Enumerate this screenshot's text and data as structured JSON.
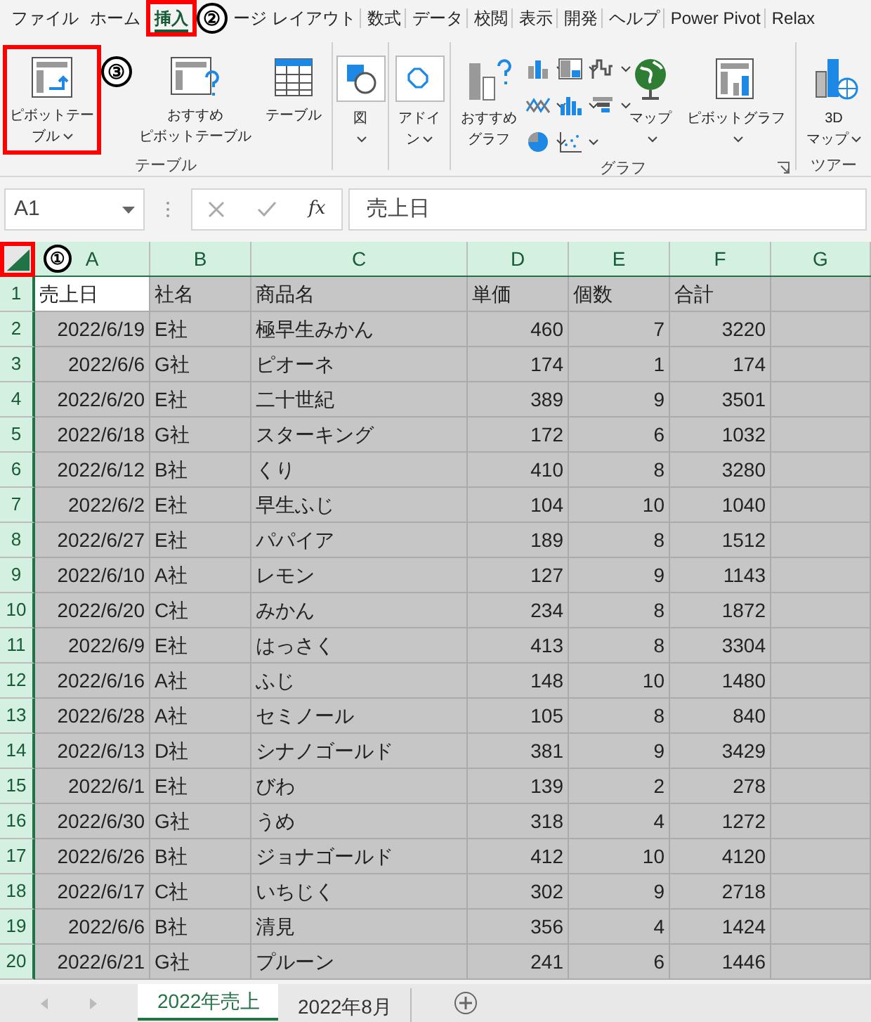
{
  "ribbon_tabs": [
    {
      "label": "ファイル",
      "selected": false,
      "highlighted": false
    },
    {
      "label": "ホーム",
      "selected": false,
      "highlighted": false
    },
    {
      "label": "挿入",
      "selected": true,
      "highlighted": true
    },
    {
      "label": "ージ レイアウト",
      "selected": false,
      "highlighted": false
    },
    {
      "label": "数式",
      "selected": false,
      "highlighted": false
    },
    {
      "label": "データ",
      "selected": false,
      "highlighted": false
    },
    {
      "label": "校閲",
      "selected": false,
      "highlighted": false
    },
    {
      "label": "表示",
      "selected": false,
      "highlighted": false
    },
    {
      "label": "開発",
      "selected": false,
      "highlighted": false
    },
    {
      "label": "ヘルプ",
      "selected": false,
      "highlighted": false
    },
    {
      "label": "Power Pivot",
      "selected": false,
      "highlighted": false
    },
    {
      "label": "Relax",
      "selected": false,
      "highlighted": false
    }
  ],
  "ribbon_groups": [
    {
      "label": "テーブル",
      "launcher": false,
      "buttons": [
        {
          "kind": "large",
          "lines": [
            "ピボットテー",
            "ブル"
          ],
          "dropdown": true,
          "highlighted": true
        },
        {
          "kind": "large",
          "lines": [
            "おすすめ",
            "ピボットテーブル"
          ],
          "dropdown": false,
          "highlighted": false
        },
        {
          "kind": "large",
          "lines": [
            "テーブル"
          ],
          "dropdown": false,
          "highlighted": false
        }
      ]
    },
    {
      "launcher": false,
      "buttons": [
        {
          "kind": "large",
          "lines": [
            "図"
          ],
          "dropdown": true,
          "highlighted": false
        }
      ]
    },
    {
      "launcher": false,
      "buttons": [
        {
          "kind": "large",
          "lines": [
            "アドイ",
            "ン"
          ],
          "dropdown": true,
          "highlighted": false
        }
      ]
    },
    {
      "label": "グラフ",
      "launcher": true,
      "buttons": [
        {
          "kind": "large",
          "lines": [
            "おすすめ",
            "グラフ"
          ],
          "dropdown": false,
          "highlighted": false
        },
        {
          "kind": "gallery"
        },
        {
          "kind": "large",
          "lines": [
            "マップ"
          ],
          "dropdown": true,
          "highlighted": false
        },
        {
          "kind": "large",
          "lines": [
            "ピボットグラフ"
          ],
          "dropdown": true,
          "highlighted": false
        }
      ]
    },
    {
      "label": "ツアー",
      "launcher": false,
      "buttons": [
        {
          "kind": "large",
          "lines": [
            "3D",
            "マップ"
          ],
          "dropdown": true,
          "highlighted": false
        }
      ]
    }
  ],
  "formula_bar": {
    "name_box": "A1",
    "function_label": "fx",
    "formula": "売上日"
  },
  "callouts": [
    "①",
    "②",
    "③"
  ],
  "sheet": {
    "all_selected": true,
    "corner_highlighted": true,
    "columns": [
      {
        "label": "A"
      },
      {
        "label": "B"
      },
      {
        "label": "C"
      },
      {
        "label": "D"
      },
      {
        "label": "E"
      },
      {
        "label": "F"
      },
      {
        "label": "G"
      }
    ],
    "rows": [
      {
        "number": "1",
        "cells": [
          "売上日",
          "社名",
          "商品名",
          "単価",
          "個数",
          "合計"
        ]
      },
      {
        "number": "2",
        "cells": [
          "2022/6/19",
          "E社",
          "極早生みかん",
          "460",
          "7",
          "3220"
        ]
      },
      {
        "number": "3",
        "cells": [
          "2022/6/6",
          "G社",
          "ピオーネ",
          "174",
          "1",
          "174"
        ]
      },
      {
        "number": "4",
        "cells": [
          "2022/6/20",
          "E社",
          "二十世紀",
          "389",
          "9",
          "3501"
        ]
      },
      {
        "number": "5",
        "cells": [
          "2022/6/18",
          "G社",
          "スターキング",
          "172",
          "6",
          "1032"
        ]
      },
      {
        "number": "6",
        "cells": [
          "2022/6/12",
          "B社",
          "くり",
          "410",
          "8",
          "3280"
        ]
      },
      {
        "number": "7",
        "cells": [
          "2022/6/2",
          "E社",
          "早生ふじ",
          "104",
          "10",
          "1040"
        ]
      },
      {
        "number": "8",
        "cells": [
          "2022/6/27",
          "E社",
          "パパイア",
          "189",
          "8",
          "1512"
        ]
      },
      {
        "number": "9",
        "cells": [
          "2022/6/10",
          "A社",
          "レモン",
          "127",
          "9",
          "1143"
        ]
      },
      {
        "number": "10",
        "cells": [
          "2022/6/20",
          "C社",
          "みかん",
          "234",
          "8",
          "1872"
        ]
      },
      {
        "number": "11",
        "cells": [
          "2022/6/9",
          "E社",
          "はっさく",
          "413",
          "8",
          "3304"
        ]
      },
      {
        "number": "12",
        "cells": [
          "2022/6/16",
          "A社",
          "ふじ",
          "148",
          "10",
          "1480"
        ]
      },
      {
        "number": "13",
        "cells": [
          "2022/6/28",
          "A社",
          "セミノール",
          "105",
          "8",
          "840"
        ]
      },
      {
        "number": "14",
        "cells": [
          "2022/6/13",
          "D社",
          "シナノゴールド",
          "381",
          "9",
          "3429"
        ]
      },
      {
        "number": "15",
        "cells": [
          "2022/6/1",
          "E社",
          "びわ",
          "139",
          "2",
          "278"
        ]
      },
      {
        "number": "16",
        "cells": [
          "2022/6/30",
          "G社",
          "うめ",
          "318",
          "4",
          "1272"
        ]
      },
      {
        "number": "17",
        "cells": [
          "2022/6/26",
          "B社",
          "ジョナゴールド",
          "412",
          "10",
          "4120"
        ]
      },
      {
        "number": "18",
        "cells": [
          "2022/6/17",
          "C社",
          "いちじく",
          "302",
          "9",
          "2718"
        ]
      },
      {
        "number": "19",
        "cells": [
          "2022/6/6",
          "B社",
          "清見",
          "356",
          "4",
          "1424"
        ]
      },
      {
        "number": "20",
        "cells": [
          "2022/6/21",
          "G社",
          "プルーン",
          "241",
          "6",
          "1446"
        ]
      }
    ]
  },
  "sheet_tabs": [
    {
      "label": "2022年売上",
      "selected": true
    },
    {
      "label": "2022年8月",
      "selected": false
    }
  ]
}
